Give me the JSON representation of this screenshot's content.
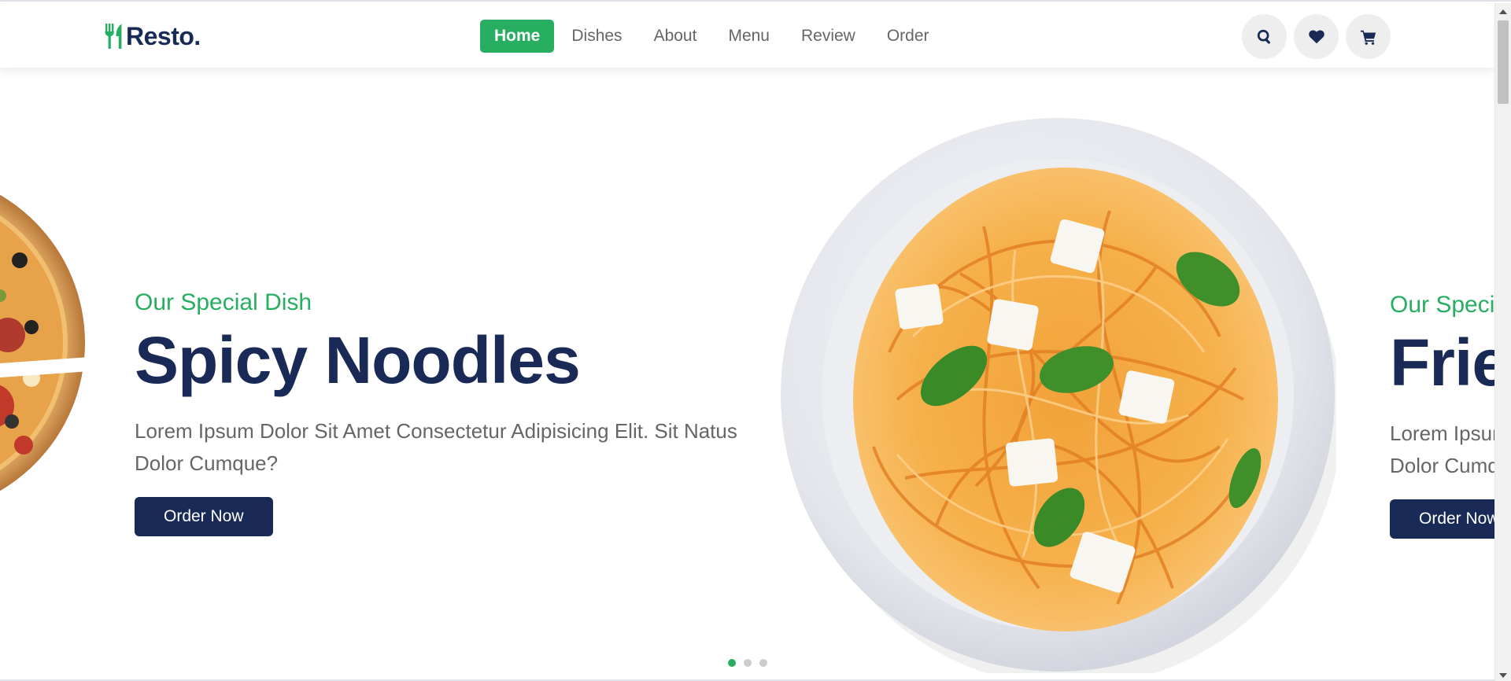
{
  "brand": {
    "name": "Resto.",
    "accent": "#27ae60",
    "dark": "#192a56"
  },
  "nav": {
    "items": [
      {
        "label": "Home",
        "active": true
      },
      {
        "label": "Dishes",
        "active": false
      },
      {
        "label": "About",
        "active": false
      },
      {
        "label": "Menu",
        "active": false
      },
      {
        "label": "Review",
        "active": false
      },
      {
        "label": "Order",
        "active": false
      }
    ]
  },
  "header_icons": [
    "search-icon",
    "heart-icon",
    "cart-icon"
  ],
  "slides": [
    {
      "subtitle": "Our Special Dish",
      "title": "Spicy Noodles",
      "description": "Lorem Ipsum Dolor Sit Amet Consectetur Adipisicing Elit. Sit Natus Dolor Cumque?",
      "button": "Order Now"
    },
    {
      "subtitle": "Our Special Dish",
      "title": "Fried Chicken",
      "description": "Lorem Ipsum Dolor Sit Amet Consectetur Adipisicing Elit. Sit Natus Dolor Cumque?",
      "button": "Order Now"
    }
  ],
  "pagination": {
    "count": 3,
    "active_index": 0
  }
}
